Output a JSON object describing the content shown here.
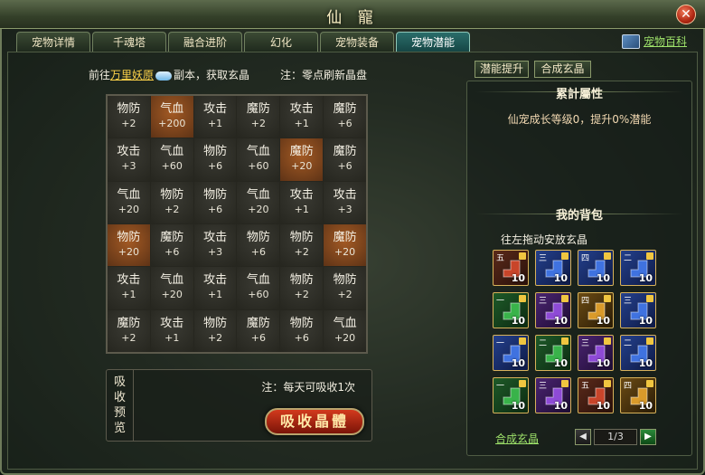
{
  "window": {
    "title": "仙 寵",
    "close_icon": "close-icon"
  },
  "tabs": [
    {
      "label": "宠物详情",
      "active": false
    },
    {
      "label": "千魂塔",
      "active": false
    },
    {
      "label": "融合进阶",
      "active": false
    },
    {
      "label": "幻化",
      "active": false
    },
    {
      "label": "宠物装备",
      "active": false
    },
    {
      "label": "宠物潜能",
      "active": true
    }
  ],
  "pet_wiki": {
    "label": "宠物百科",
    "icon": "book-icon"
  },
  "hint": {
    "prefix": "前往",
    "link": "万里妖原",
    "suffix": "副本，获取玄晶",
    "icon": "cloud-icon"
  },
  "note_top": "注：零点刷新晶盘",
  "grid": [
    [
      {
        "stat": "物防",
        "val": "+2",
        "hl": false
      },
      {
        "stat": "气血",
        "val": "+200",
        "hl": true
      },
      {
        "stat": "攻击",
        "val": "+1",
        "hl": false
      },
      {
        "stat": "魔防",
        "val": "+2",
        "hl": false
      },
      {
        "stat": "攻击",
        "val": "+1",
        "hl": false
      },
      {
        "stat": "魔防",
        "val": "+6",
        "hl": false
      }
    ],
    [
      {
        "stat": "攻击",
        "val": "+3",
        "hl": false
      },
      {
        "stat": "气血",
        "val": "+60",
        "hl": false
      },
      {
        "stat": "物防",
        "val": "+6",
        "hl": false
      },
      {
        "stat": "气血",
        "val": "+60",
        "hl": false
      },
      {
        "stat": "魔防",
        "val": "+20",
        "hl": true
      },
      {
        "stat": "魔防",
        "val": "+6",
        "hl": false
      }
    ],
    [
      {
        "stat": "气血",
        "val": "+20",
        "hl": false
      },
      {
        "stat": "物防",
        "val": "+2",
        "hl": false
      },
      {
        "stat": "物防",
        "val": "+6",
        "hl": false
      },
      {
        "stat": "气血",
        "val": "+20",
        "hl": false
      },
      {
        "stat": "攻击",
        "val": "+1",
        "hl": false
      },
      {
        "stat": "攻击",
        "val": "+3",
        "hl": false
      }
    ],
    [
      {
        "stat": "物防",
        "val": "+20",
        "hl": true
      },
      {
        "stat": "魔防",
        "val": "+6",
        "hl": false
      },
      {
        "stat": "攻击",
        "val": "+3",
        "hl": false
      },
      {
        "stat": "物防",
        "val": "+6",
        "hl": false
      },
      {
        "stat": "物防",
        "val": "+2",
        "hl": false
      },
      {
        "stat": "魔防",
        "val": "+20",
        "hl": true
      }
    ],
    [
      {
        "stat": "攻击",
        "val": "+1",
        "hl": false
      },
      {
        "stat": "气血",
        "val": "+20",
        "hl": false
      },
      {
        "stat": "攻击",
        "val": "+1",
        "hl": false
      },
      {
        "stat": "气血",
        "val": "+60",
        "hl": false
      },
      {
        "stat": "物防",
        "val": "+2",
        "hl": false
      },
      {
        "stat": "物防",
        "val": "+2",
        "hl": false
      }
    ],
    [
      {
        "stat": "魔防",
        "val": "+2",
        "hl": false
      },
      {
        "stat": "攻击",
        "val": "+1",
        "hl": false
      },
      {
        "stat": "物防",
        "val": "+2",
        "hl": false
      },
      {
        "stat": "魔防",
        "val": "+6",
        "hl": false
      },
      {
        "stat": "物防",
        "val": "+6",
        "hl": false
      },
      {
        "stat": "气血",
        "val": "+20",
        "hl": false
      }
    ]
  ],
  "absorb": {
    "label_lines": [
      "吸",
      "收",
      "预",
      "览"
    ],
    "note": "注：每天可吸收1次",
    "button_label": "吸收晶體"
  },
  "right_tabs": [
    {
      "label": "潜能提升"
    },
    {
      "label": "合成玄晶"
    }
  ],
  "stats_section": {
    "title": "累計屬性",
    "growth": "仙宠成长等级0，提升0%潜能"
  },
  "bag_section": {
    "title": "我的背包",
    "hint": "往左拖动安放玄晶"
  },
  "bag": [
    {
      "num": "五",
      "count": "10",
      "color": "red",
      "shape_color": "#c8452a"
    },
    {
      "num": "三",
      "count": "10",
      "color": "blue",
      "shape_color": "#3f72e0"
    },
    {
      "num": "四",
      "count": "10",
      "color": "blue",
      "shape_color": "#3f72e0"
    },
    {
      "num": "二",
      "count": "10",
      "color": "blue",
      "shape_color": "#3f72e0"
    },
    {
      "num": "一",
      "count": "10",
      "color": "green",
      "shape_color": "#39b34a"
    },
    {
      "num": "三",
      "count": "10",
      "color": "purple",
      "shape_color": "#8e4ad6"
    },
    {
      "num": "四",
      "count": "10",
      "color": "gold",
      "shape_color": "#d99a2a"
    },
    {
      "num": "三",
      "count": "10",
      "color": "blue",
      "shape_color": "#3f72e0"
    },
    {
      "num": "一",
      "count": "10",
      "color": "blue",
      "shape_color": "#3f72e0"
    },
    {
      "num": "二",
      "count": "10",
      "color": "green",
      "shape_color": "#39b34a"
    },
    {
      "num": "三",
      "count": "10",
      "color": "purple",
      "shape_color": "#8e4ad6"
    },
    {
      "num": "二",
      "count": "10",
      "color": "blue",
      "shape_color": "#3f72e0"
    },
    {
      "num": "一",
      "count": "10",
      "color": "green",
      "shape_color": "#39b34a"
    },
    {
      "num": "三",
      "count": "10",
      "color": "purple",
      "shape_color": "#8e4ad6"
    },
    {
      "num": "五",
      "count": "10",
      "color": "red",
      "shape_color": "#c8452a"
    },
    {
      "num": "四",
      "count": "10",
      "color": "gold",
      "shape_color": "#d99a2a"
    }
  ],
  "merge_link": "合成玄晶",
  "pager": {
    "label": "1/3",
    "prev_icon": "prev-arrow-icon",
    "next_icon": "next-arrow-icon"
  }
}
